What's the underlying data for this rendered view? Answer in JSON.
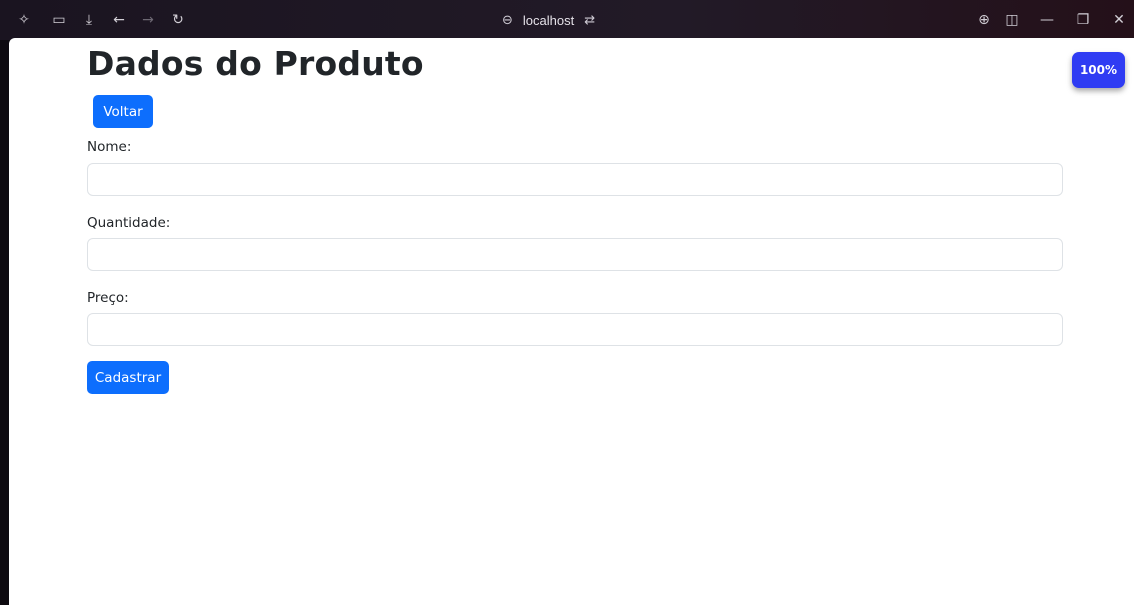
{
  "browser": {
    "address": "localhost",
    "icons": [
      "extension-icon",
      "sidebar-icon",
      "download-icon",
      "back-icon",
      "forward-icon",
      "reload-icon",
      "link-icon",
      "site-settings-icon",
      "translate-icon",
      "split-view-icon",
      "minimize-icon",
      "restore-icon",
      "close-icon"
    ],
    "glyphs": {
      "extension": "✧",
      "sidebar": "▭",
      "download": "⤓",
      "back": "←",
      "forward": "→",
      "reload": "↻",
      "link": "⊖",
      "site_settings": "⇄",
      "translate": "⊕",
      "split_view": "◫",
      "minimize": "—",
      "restore": "❐",
      "close": "✕"
    }
  },
  "page": {
    "title": "Dados do Produto",
    "back_button": "Voltar",
    "fields": [
      {
        "label": "Nome:",
        "value": ""
      },
      {
        "label": "Quantidade:",
        "value": ""
      },
      {
        "label": "Preço:",
        "value": ""
      }
    ],
    "submit_button": "Cadastrar"
  },
  "zoom_badge": "100%",
  "colors": {
    "primary": "#0d6efd",
    "zoom_badge": "#2f3cf3",
    "text": "#212529",
    "input_border": "#dee2e6"
  }
}
